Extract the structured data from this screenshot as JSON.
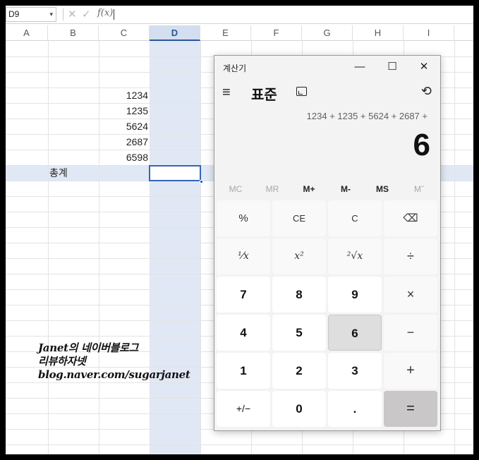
{
  "formula_bar": {
    "name_box": "D9",
    "cancel_icon": "✕",
    "confirm_icon": "✓",
    "function_icon": "f(x)",
    "value": ""
  },
  "spreadsheet": {
    "columns": [
      "A",
      "B",
      "C",
      "D",
      "E",
      "F",
      "G",
      "H",
      "I"
    ],
    "selected_column": "D",
    "values": [
      "1234",
      "1235",
      "5624",
      "2687",
      "6598"
    ],
    "total_label": "총계",
    "active_cell_value": "",
    "selection_color": "#e1e8f5",
    "accent": "#3166b8"
  },
  "watermark": {
    "line1": "Janet의 네이버블로그",
    "line2": "리뷰하자넷",
    "line3": "blog.naver.com/sugarjanet"
  },
  "calculator": {
    "title": "계산기",
    "minimize_icon": "—",
    "maximize_icon": "☐",
    "close_icon": "✕",
    "menu_icon": "≡",
    "mode": "표준",
    "history_icon": "⟲",
    "expression": "1234 + 1235 + 5624 + 2687 +",
    "display": "6",
    "memory": [
      "MC",
      "MR",
      "M+",
      "M-",
      "MS",
      "Mˇ"
    ],
    "keys": [
      [
        "%",
        "CE",
        "C",
        "⌫"
      ],
      [
        "⅟x",
        "x²",
        "²√x",
        "÷"
      ],
      [
        "7",
        "8",
        "9",
        "×"
      ],
      [
        "4",
        "5",
        "6",
        "−"
      ],
      [
        "1",
        "2",
        "3",
        "+"
      ],
      [
        "+/−",
        "0",
        ".",
        "="
      ]
    ]
  }
}
